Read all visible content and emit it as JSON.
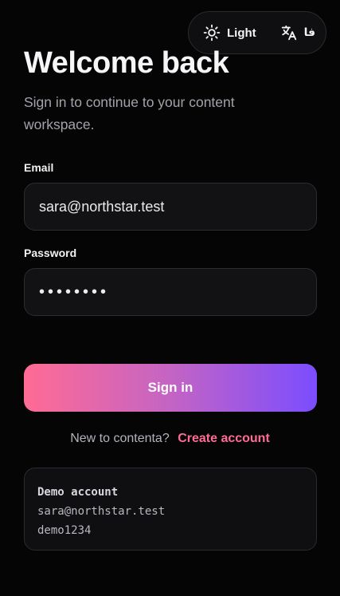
{
  "toolbar": {
    "theme_label": "Light",
    "theme_icon": "sun-icon",
    "language_label": "فا",
    "language_icon": "translate-icon"
  },
  "header": {
    "title": "Welcome back",
    "subtitle": "Sign in to continue to your content workspace."
  },
  "form": {
    "email_label": "Email",
    "email_value": "sara@northstar.test",
    "password_label": "Password",
    "password_masked": "••••••••",
    "submit_label": "Sign in"
  },
  "signup": {
    "prompt": "New to contenta?",
    "link_label": "Create account"
  },
  "demo": {
    "heading": "Demo account",
    "email": "sara@northstar.test",
    "password": "demo1234"
  },
  "colors": {
    "background": "#050506",
    "accent_pink": "#ff6b94",
    "accent_purple": "#7b4dff"
  }
}
